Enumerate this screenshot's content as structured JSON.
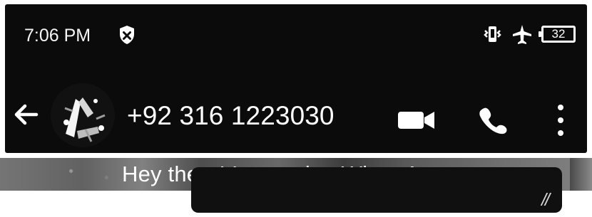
{
  "status_bar": {
    "time": "7:06 PM",
    "battery_level": "32",
    "icons": [
      "shield-icon",
      "vibrate-icon",
      "airplane-icon",
      "battery-icon"
    ]
  },
  "toolbar": {
    "contact_name": "+92 316 1223030",
    "actions": [
      "back-arrow-icon",
      "video-call-icon",
      "phone-icon",
      "more-vertical-icon"
    ]
  },
  "profile": {
    "status_text": "Hey there! I am using WhatsApp."
  },
  "message": {
    "read_receipt": "//"
  },
  "colors": {
    "toolbar_background": "#0b0b0b",
    "text": "#ffffff",
    "status_strip": "#555555"
  }
}
